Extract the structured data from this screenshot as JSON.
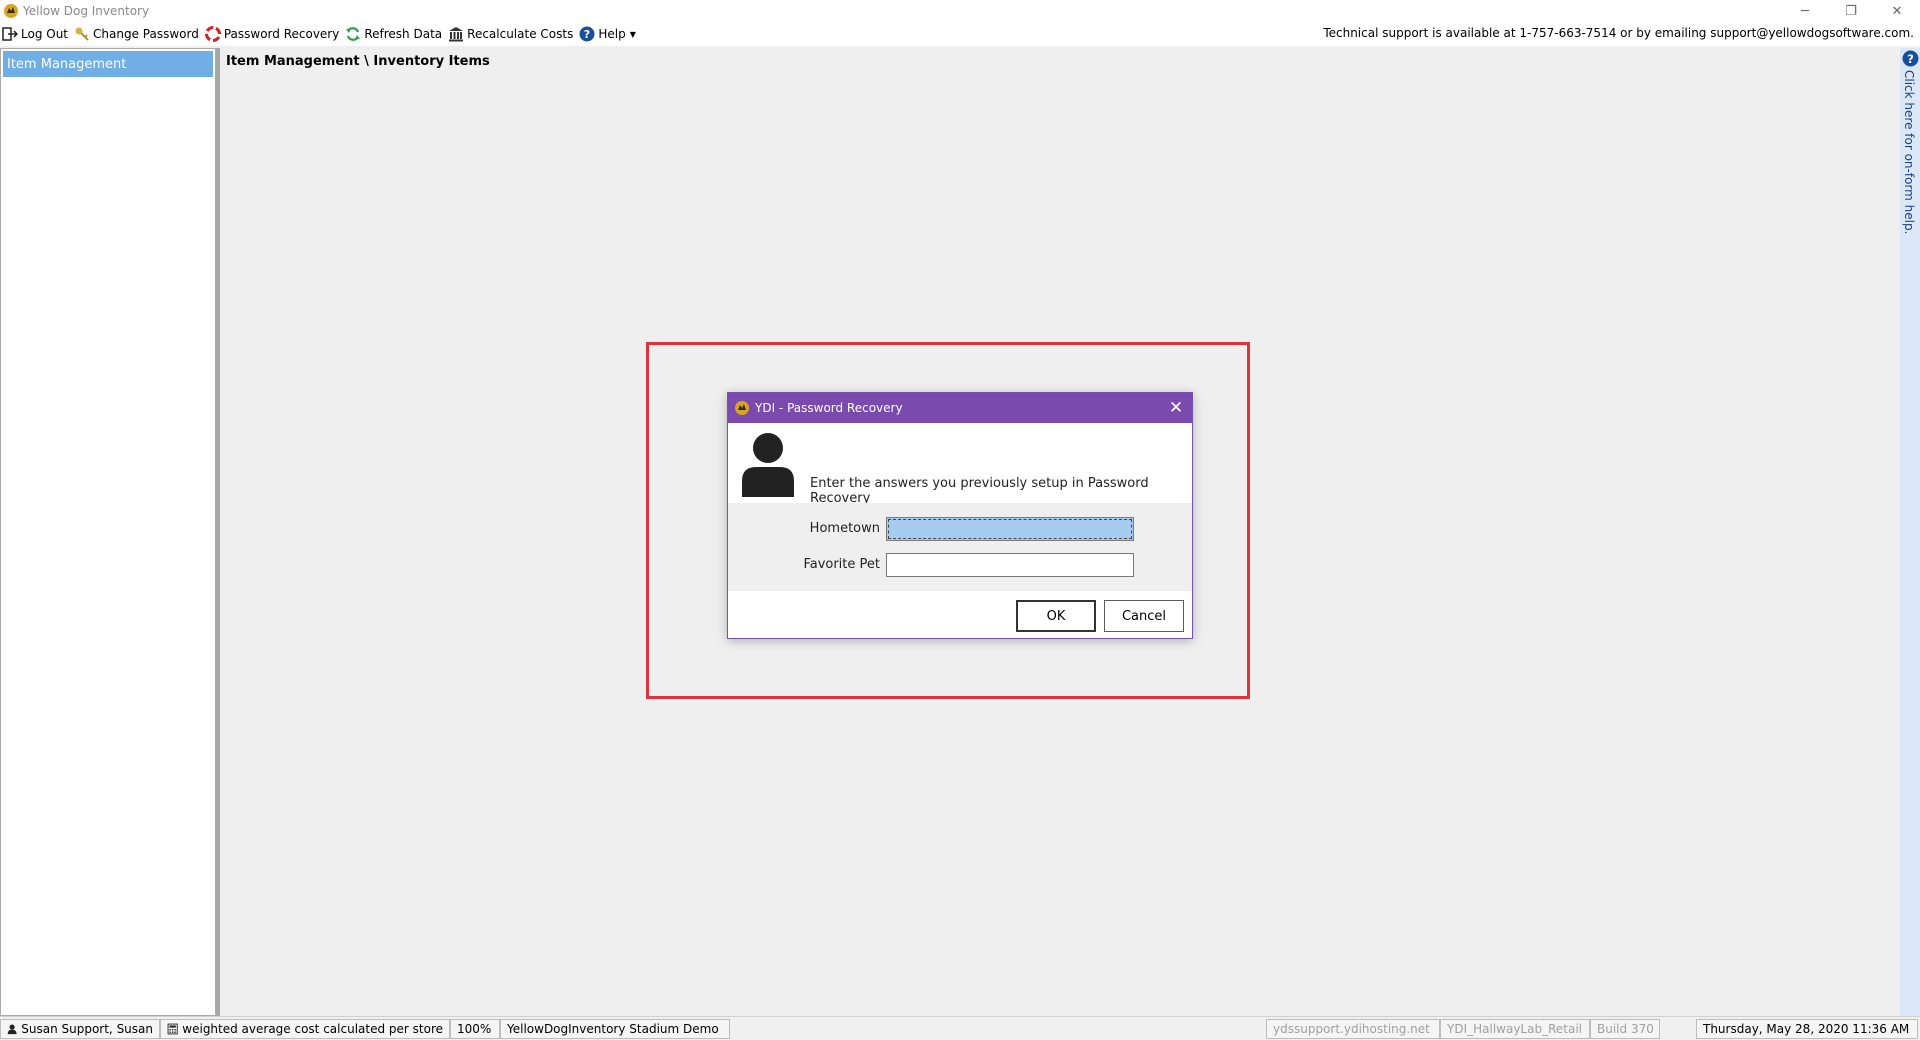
{
  "window": {
    "title": "Yellow Dog Inventory",
    "minimize": "─",
    "restore": "❐",
    "close": "✕"
  },
  "toolbar": {
    "items": [
      {
        "label": "Log Out",
        "icon": "logout-icon"
      },
      {
        "label": "Change Password",
        "icon": "key-icon"
      },
      {
        "label": "Password Recovery",
        "icon": "lifebuoy-icon"
      },
      {
        "label": "Refresh Data",
        "icon": "refresh-icon"
      },
      {
        "label": "Recalculate Costs",
        "icon": "bank-icon"
      },
      {
        "label": "Help",
        "icon": "help-icon"
      }
    ],
    "support": "Technical support is available at 1-757-663-7514 or by emailing support@yellowdogsoftware.com."
  },
  "sidebar": {
    "items": [
      {
        "label": "Item Management"
      }
    ]
  },
  "main": {
    "breadcrumb": "Item Management \\ Inventory Items"
  },
  "dialog": {
    "title": "YDI - Password Recovery",
    "close": "✕",
    "message": "Enter the answers you previously setup in Password Recovery",
    "fields": [
      {
        "label": "Hometown",
        "value": ""
      },
      {
        "label": "Favorite Pet",
        "value": ""
      }
    ],
    "ok": "OK",
    "cancel": "Cancel"
  },
  "help_strip": {
    "text": "Click here for on-form help."
  },
  "status": {
    "user": "Susan Support, Susan",
    "costing": "weighted average cost calculated per store",
    "zoom": "100%",
    "database": "YellowDogInventory Stadium Demo",
    "server": "ydssupport.ydihosting.net",
    "instance": "YDI_HallwayLab_Retail",
    "build": "Build 370",
    "datetime": "Thursday, May 28, 2020 11:36 AM"
  },
  "colors": {
    "dialog_title": "#7b4aaf",
    "sidebar_selected": "#70aee6",
    "highlight_box": "#e0333d"
  }
}
